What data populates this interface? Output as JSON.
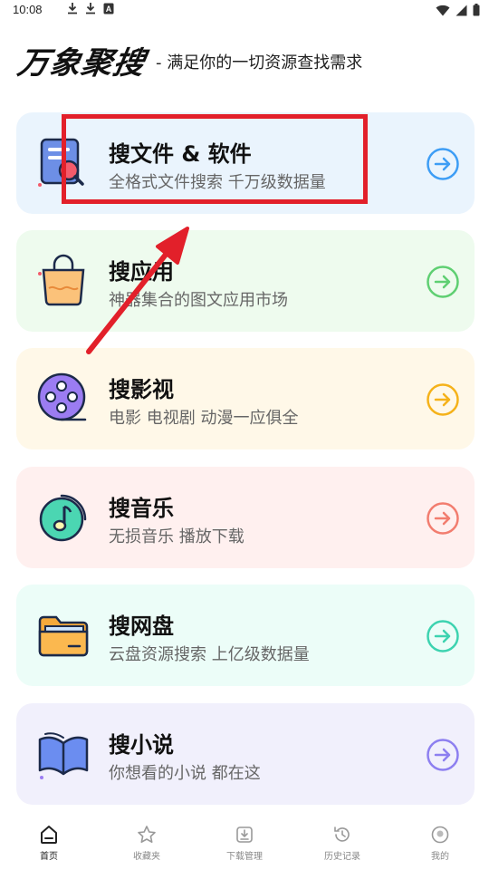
{
  "status_bar": {
    "time": "10:08",
    "icons": [
      "download-icon",
      "download-icon",
      "a-icon",
      "wifi-icon",
      "signal-icon",
      "battery-icon"
    ]
  },
  "header": {
    "logo": "万象聚搜",
    "slogan": "- 满足你的一切资源查找需求"
  },
  "cards": [
    {
      "title": "搜文件 & 软件",
      "subtitle": "全格式文件搜索 千万级数据量",
      "icon": "file-search-icon",
      "bg": "#eaf4fd",
      "accent": "#3d9df5"
    },
    {
      "title": "搜应用",
      "subtitle": "神器集合的图文应用市场",
      "icon": "shopping-bag-icon",
      "bg": "#eefbee",
      "accent": "#5fcf72"
    },
    {
      "title": "搜影视",
      "subtitle": "电影 电视剧 动漫一应俱全",
      "icon": "film-reel-icon",
      "bg": "#fff8e8",
      "accent": "#f5b21a"
    },
    {
      "title": "搜音乐",
      "subtitle": "无损音乐 播放下载",
      "icon": "music-note-icon",
      "bg": "#fff0ef",
      "accent": "#f27d6f"
    },
    {
      "title": "搜网盘",
      "subtitle": "云盘资源搜索 上亿级数据量",
      "icon": "folder-icon",
      "bg": "#ecfdf8",
      "accent": "#3dd3b0"
    },
    {
      "title": "搜小说",
      "subtitle": "你想看的小说 都在这",
      "icon": "book-icon",
      "bg": "#f1f0fc",
      "accent": "#8d7ff0"
    }
  ],
  "bottom_nav": [
    {
      "label": "首页",
      "icon": "home-icon",
      "active": true
    },
    {
      "label": "收藏夹",
      "icon": "star-icon",
      "active": false
    },
    {
      "label": "下载管理",
      "icon": "download-manage-icon",
      "active": false
    },
    {
      "label": "历史记录",
      "icon": "history-icon",
      "active": false
    },
    {
      "label": "我的",
      "icon": "profile-icon",
      "active": false
    }
  ],
  "annotation_color": "#e2202a"
}
